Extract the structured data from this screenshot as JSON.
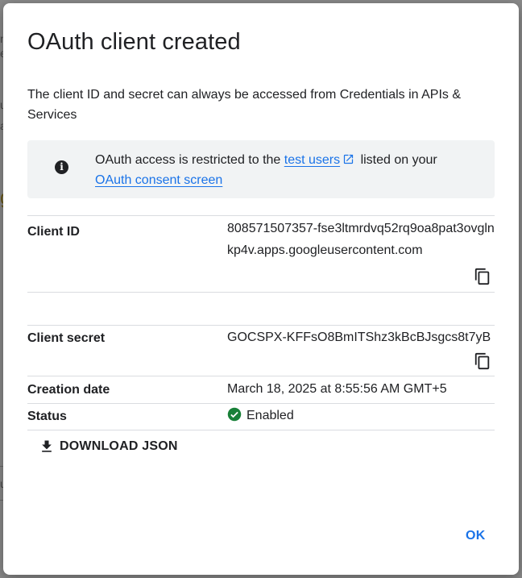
{
  "dialog": {
    "title": "OAuth client created",
    "intro": "The client ID and secret can always be accessed from Credentials in APIs & Services",
    "notice": {
      "icon": "info-icon",
      "text_before": "OAuth access is restricted to the ",
      "link_test_users": "test users",
      "text_middle": " listed on your ",
      "link_consent_screen": "OAuth consent screen"
    },
    "fields": {
      "client_id_label": "Client ID",
      "client_id_value": "808571507357-fse3ltmrdvq52rq9oa8pat3ovglnkp4v.apps.googleusercontent.com",
      "client_secret_label": "Client secret",
      "client_secret_value": "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",
      "creation_date_label": "Creation date",
      "creation_date_value": "March 18, 2025 at 8:55:56 AM GMT+5",
      "status_label": "Status",
      "status_value": "Enabled"
    },
    "download_label": "DOWNLOAD JSON",
    "ok_label": "OK"
  },
  "colors": {
    "accent": "#1a73e8",
    "status_enabled": "#188038",
    "notice_bg": "#f1f3f4",
    "text": "#202124"
  }
}
